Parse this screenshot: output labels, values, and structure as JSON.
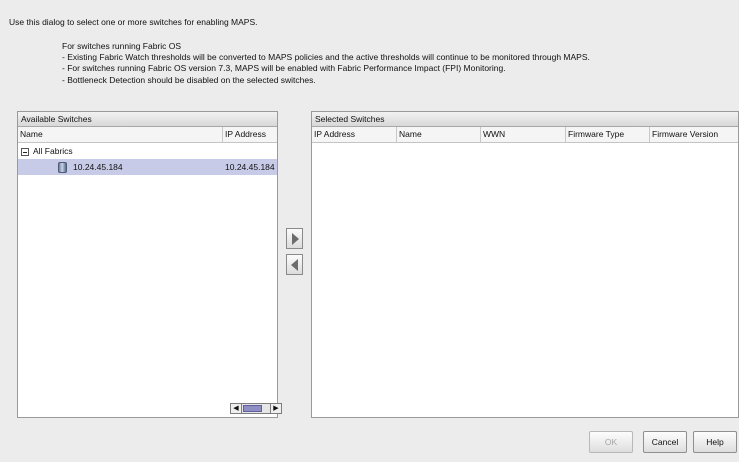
{
  "intro": "Use this dialog to select one or more switches for enabling MAPS.",
  "notes": [
    "For switches running Fabric OS",
    "- Existing Fabric Watch thresholds will be converted to MAPS policies and the active thresholds will continue to be monitored through MAPS.",
    "- For switches running Fabric OS version 7.3, MAPS will be enabled with Fabric Performance Impact (FPI) Monitoring.",
    "- Bottleneck Detection should be disabled on the selected switches."
  ],
  "available": {
    "title": "Available Switches",
    "columns": [
      "Name",
      "IP Address"
    ],
    "tree": {
      "root_label": "All Fabrics",
      "items": [
        {
          "name": "10.24.45.184",
          "ip": "10.24.45.184"
        }
      ]
    }
  },
  "selected": {
    "title": "Selected Switches",
    "columns": [
      "IP Address",
      "Name",
      "WWN",
      "Firmware Type",
      "Firmware Version"
    ]
  },
  "buttons": {
    "ok": "OK",
    "cancel": "Cancel",
    "help": "Help"
  },
  "icons": {
    "add": "arrow-right-icon",
    "remove": "arrow-left-icon",
    "switch": "switch-icon",
    "collapse": "collapse-icon"
  }
}
